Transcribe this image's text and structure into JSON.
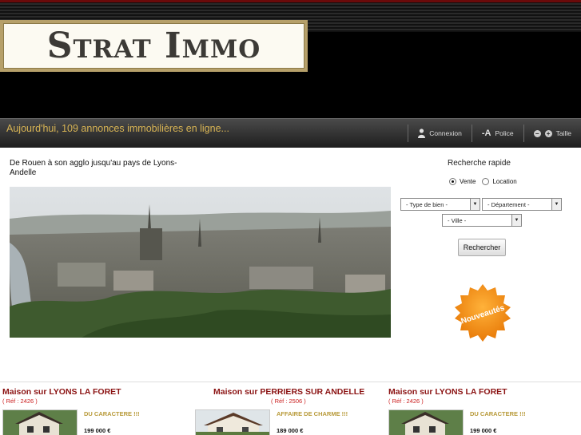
{
  "header": {
    "logo_text": "Strat Immo"
  },
  "bar": {
    "tagline": "Aujourd'hui, 109 annonces immobilières en ligne...",
    "connexion_label": "Connexion",
    "police_glyph": "-A",
    "police_label": "Police",
    "taille_minus": "−",
    "taille_plus": "+",
    "taille_label": "Taille"
  },
  "main": {
    "subtitle": "De Rouen à son agglo jusqu'au pays de Lyons-Andelle"
  },
  "search": {
    "title": "Recherche rapide",
    "radio_vente": "Vente",
    "radio_location": "Location",
    "selected": "Vente",
    "type_bien": "- Type de bien -",
    "departement": "- Département -",
    "ville": "- Ville -",
    "submit_label": "Rechercher"
  },
  "badge": {
    "text": "Nouveautés",
    "color": "#f08a10"
  },
  "listings": [
    {
      "title": "Maison sur LYONS LA FORET",
      "ref": "( Réf : 2426 )",
      "desc": "DU CARACTERE !!!",
      "price": "199 000 €"
    },
    {
      "title": "Maison sur PERRIERS SUR ANDELLE",
      "ref": "( Réf : 2506 )",
      "desc": "AFFAIRE DE CHARME !!!",
      "price": "189 000 €"
    },
    {
      "title": "Maison sur LYONS LA FORET",
      "ref": "( Réf : 2426 )",
      "desc": "DU CARACTERE !!!",
      "price": "199 000 €"
    }
  ],
  "colors": {
    "accent_gold": "#d8b454",
    "listing_title": "#8b1313"
  }
}
